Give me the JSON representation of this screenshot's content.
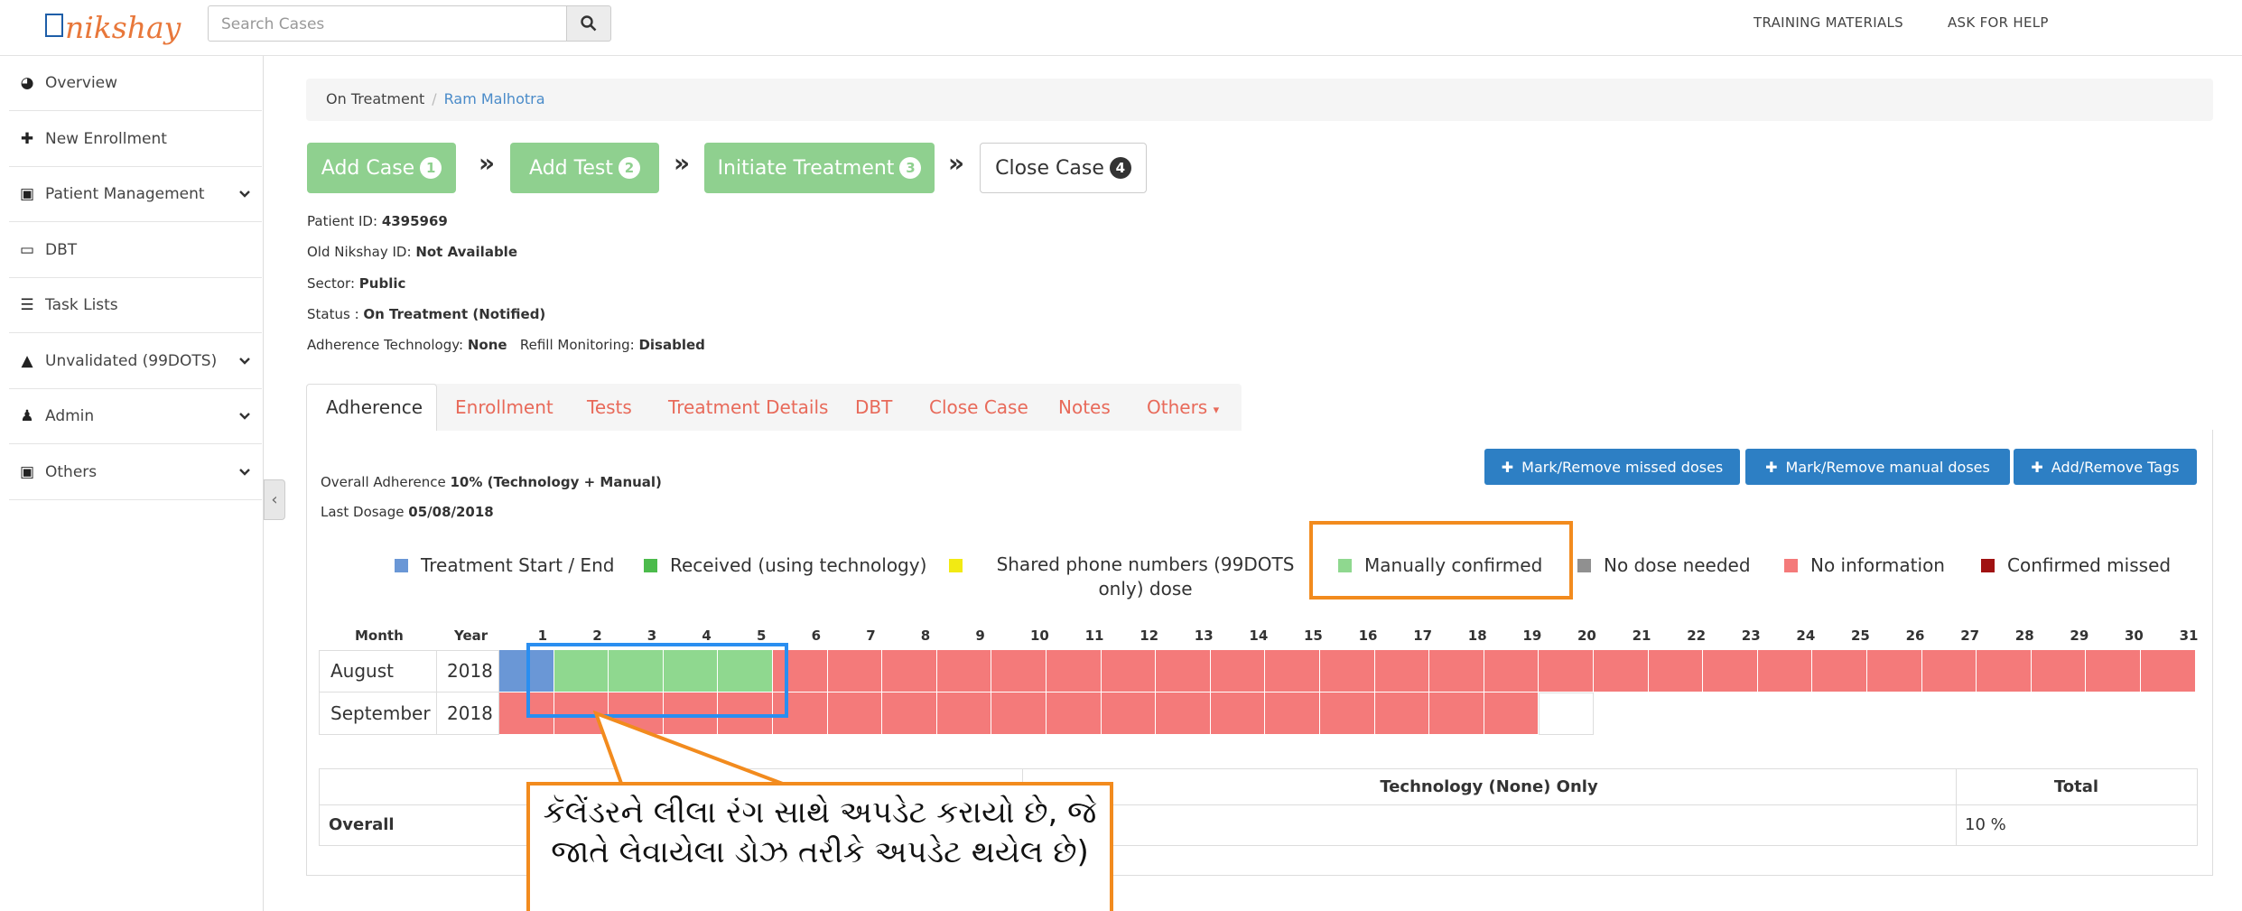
{
  "header": {
    "logo_text": "nikshay",
    "search_placeholder": "Search Cases",
    "links": [
      "TRAINING MATERIALS",
      "ASK FOR HELP"
    ]
  },
  "sidebar": {
    "items": [
      {
        "label": "Overview",
        "icon": "dashboard-icon",
        "chevron": false
      },
      {
        "label": "New Enrollment",
        "icon": "plus-icon",
        "chevron": false
      },
      {
        "label": "Patient Management",
        "icon": "briefcase-icon",
        "chevron": true
      },
      {
        "label": "DBT",
        "icon": "money-icon",
        "chevron": false
      },
      {
        "label": "Task Lists",
        "icon": "list-icon",
        "chevron": false
      },
      {
        "label": "Unvalidated (99DOTS)",
        "icon": "warning-icon",
        "chevron": true
      },
      {
        "label": "Admin",
        "icon": "user-icon",
        "chevron": true
      },
      {
        "label": "Others",
        "icon": "briefcase-icon",
        "chevron": true
      }
    ]
  },
  "breadcrumb": {
    "root": "On Treatment",
    "current": "Ram Malhotra"
  },
  "steps": [
    {
      "label": "Add Case",
      "num": "1"
    },
    {
      "label": "Add Test",
      "num": "2"
    },
    {
      "label": "Initiate Treatment",
      "num": "3"
    },
    {
      "label": "Close Case",
      "num": "4"
    }
  ],
  "patient": {
    "id_label": "Patient ID:",
    "id": "4395969",
    "old_label": "Old Nikshay ID:",
    "old_id": "Not Available",
    "sector_label": "Sector:",
    "sector": "Public",
    "status_label": "Status :",
    "status": "On Treatment (Notified)",
    "tech_label": "Adherence Technology:",
    "tech": "None",
    "refill_label": "Refill Monitoring:",
    "refill": "Disabled"
  },
  "tabs": [
    "Adherence",
    "Enrollment",
    "Tests",
    "Treatment Details",
    "DBT",
    "Close Case",
    "Notes",
    "Others"
  ],
  "adherence": {
    "overall_label": "Overall Adherence",
    "overall_value": "10% (Technology + Manual)",
    "last_label": "Last Dosage",
    "last_value": "05/08/2018",
    "buttons": [
      "Mark/Remove missed doses",
      "Mark/Remove manual doses",
      "Add/Remove Tags"
    ]
  },
  "legend": [
    {
      "label": "Treatment Start / End",
      "color": "#6a97d6"
    },
    {
      "label": "Received (using technology)",
      "color": "#4cbb4c"
    },
    {
      "label": "Shared phone numbers (99DOTS only) dose",
      "color": "#f2ea13"
    },
    {
      "label": "Manually confirmed",
      "color": "#8fd88f"
    },
    {
      "label": "No dose needed",
      "color": "#909090"
    },
    {
      "label": "No information",
      "color": "#f47a7a"
    },
    {
      "label": "Confirmed missed",
      "color": "#a01212"
    }
  ],
  "calendar": {
    "headers": [
      "Month",
      "Year"
    ],
    "days": [
      "1",
      "2",
      "3",
      "4",
      "5",
      "6",
      "7",
      "8",
      "9",
      "10",
      "11",
      "12",
      "13",
      "14",
      "15",
      "16",
      "17",
      "18",
      "19",
      "20",
      "21",
      "22",
      "23",
      "24",
      "25",
      "26",
      "27",
      "28",
      "29",
      "30",
      "31"
    ],
    "rows": [
      {
        "month": "August",
        "year": "2018",
        "cells": [
          "start",
          "manual",
          "manual",
          "manual",
          "manual",
          "noinfo",
          "noinfo",
          "noinfo",
          "noinfo",
          "noinfo",
          "noinfo",
          "noinfo",
          "noinfo",
          "noinfo",
          "noinfo",
          "noinfo",
          "noinfo",
          "noinfo",
          "noinfo",
          "noinfo",
          "noinfo",
          "noinfo",
          "noinfo",
          "noinfo",
          "noinfo",
          "noinfo",
          "noinfo",
          "noinfo",
          "noinfo",
          "noinfo",
          "noinfo"
        ]
      },
      {
        "month": "September",
        "year": "2018",
        "cells": [
          "noinfo",
          "noinfo",
          "noinfo",
          "noinfo",
          "noinfo",
          "noinfo",
          "noinfo",
          "noinfo",
          "noinfo",
          "noinfo",
          "noinfo",
          "noinfo",
          "noinfo",
          "noinfo",
          "noinfo",
          "noinfo",
          "noinfo",
          "noinfo",
          "noinfo",
          "empty"
        ]
      }
    ]
  },
  "summary": {
    "headers": [
      "Technology (None) Only",
      "Total"
    ],
    "row_label": "Overall",
    "total_value": "10 %"
  },
  "callout_text": "કૅલેંડરને લીલા રંગ સાથે અપડેટ કરાયો છે, જે જાતે લેવાયેલા ડોઝ તરીકે અપડેટ થયેલ છે)"
}
